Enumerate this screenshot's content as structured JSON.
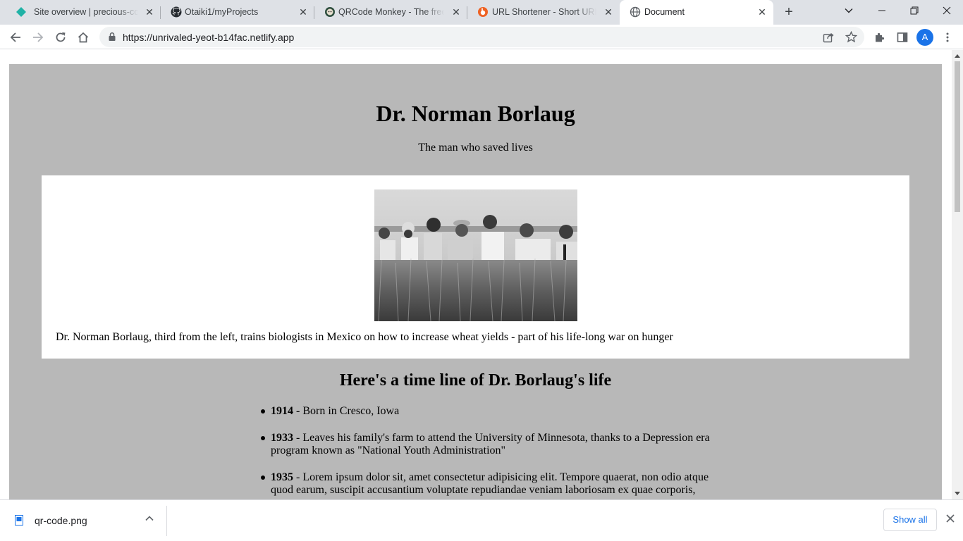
{
  "browser": {
    "tabs": [
      {
        "title": "Site overview | precious-cobb",
        "icon": "netlify-diamond-icon",
        "active": false
      },
      {
        "title": "Otaiki1/myProjects",
        "icon": "github-icon",
        "active": false
      },
      {
        "title": "QRCode Monkey - The free Q",
        "icon": "qrcode-monkey-icon",
        "active": false
      },
      {
        "title": "URL Shortener - Short URLs &",
        "icon": "bitly-icon",
        "active": false
      },
      {
        "title": "Document",
        "icon": "globe-icon",
        "active": true
      }
    ],
    "url": "https://unrivaled-yeot-b14fac.netlify.app",
    "profile_initial": "A",
    "accent_color": "#1a73e8"
  },
  "page": {
    "title": "Dr. Norman Borlaug",
    "tagline": "The man who saved lives",
    "image_caption": "Dr. Norman Borlaug, third from the left, trains biologists in Mexico on how to increase wheat yields - part of his life-long war on hunger",
    "timeline_heading": "Here's a time line of Dr. Borlaug's life",
    "timeline": [
      {
        "year": "1914",
        "text": " - Born in Cresco, Iowa"
      },
      {
        "year": "1933",
        "text": " - Leaves his family's farm to attend the University of Minnesota, thanks to a Depression era program known as \"National Youth Administration\""
      },
      {
        "year": "1935",
        "text": " - Lorem ipsum dolor sit, amet consectetur adipisicing elit. Tempore quaerat, non odio atque quod earum, suscipit accusantium voluptate repudiandae veniam laboriosam ex quae corporis,"
      }
    ],
    "background_color": "#b8b8b8"
  },
  "downloads": {
    "file_name": "qr-code.png",
    "show_all_label": "Show all"
  }
}
